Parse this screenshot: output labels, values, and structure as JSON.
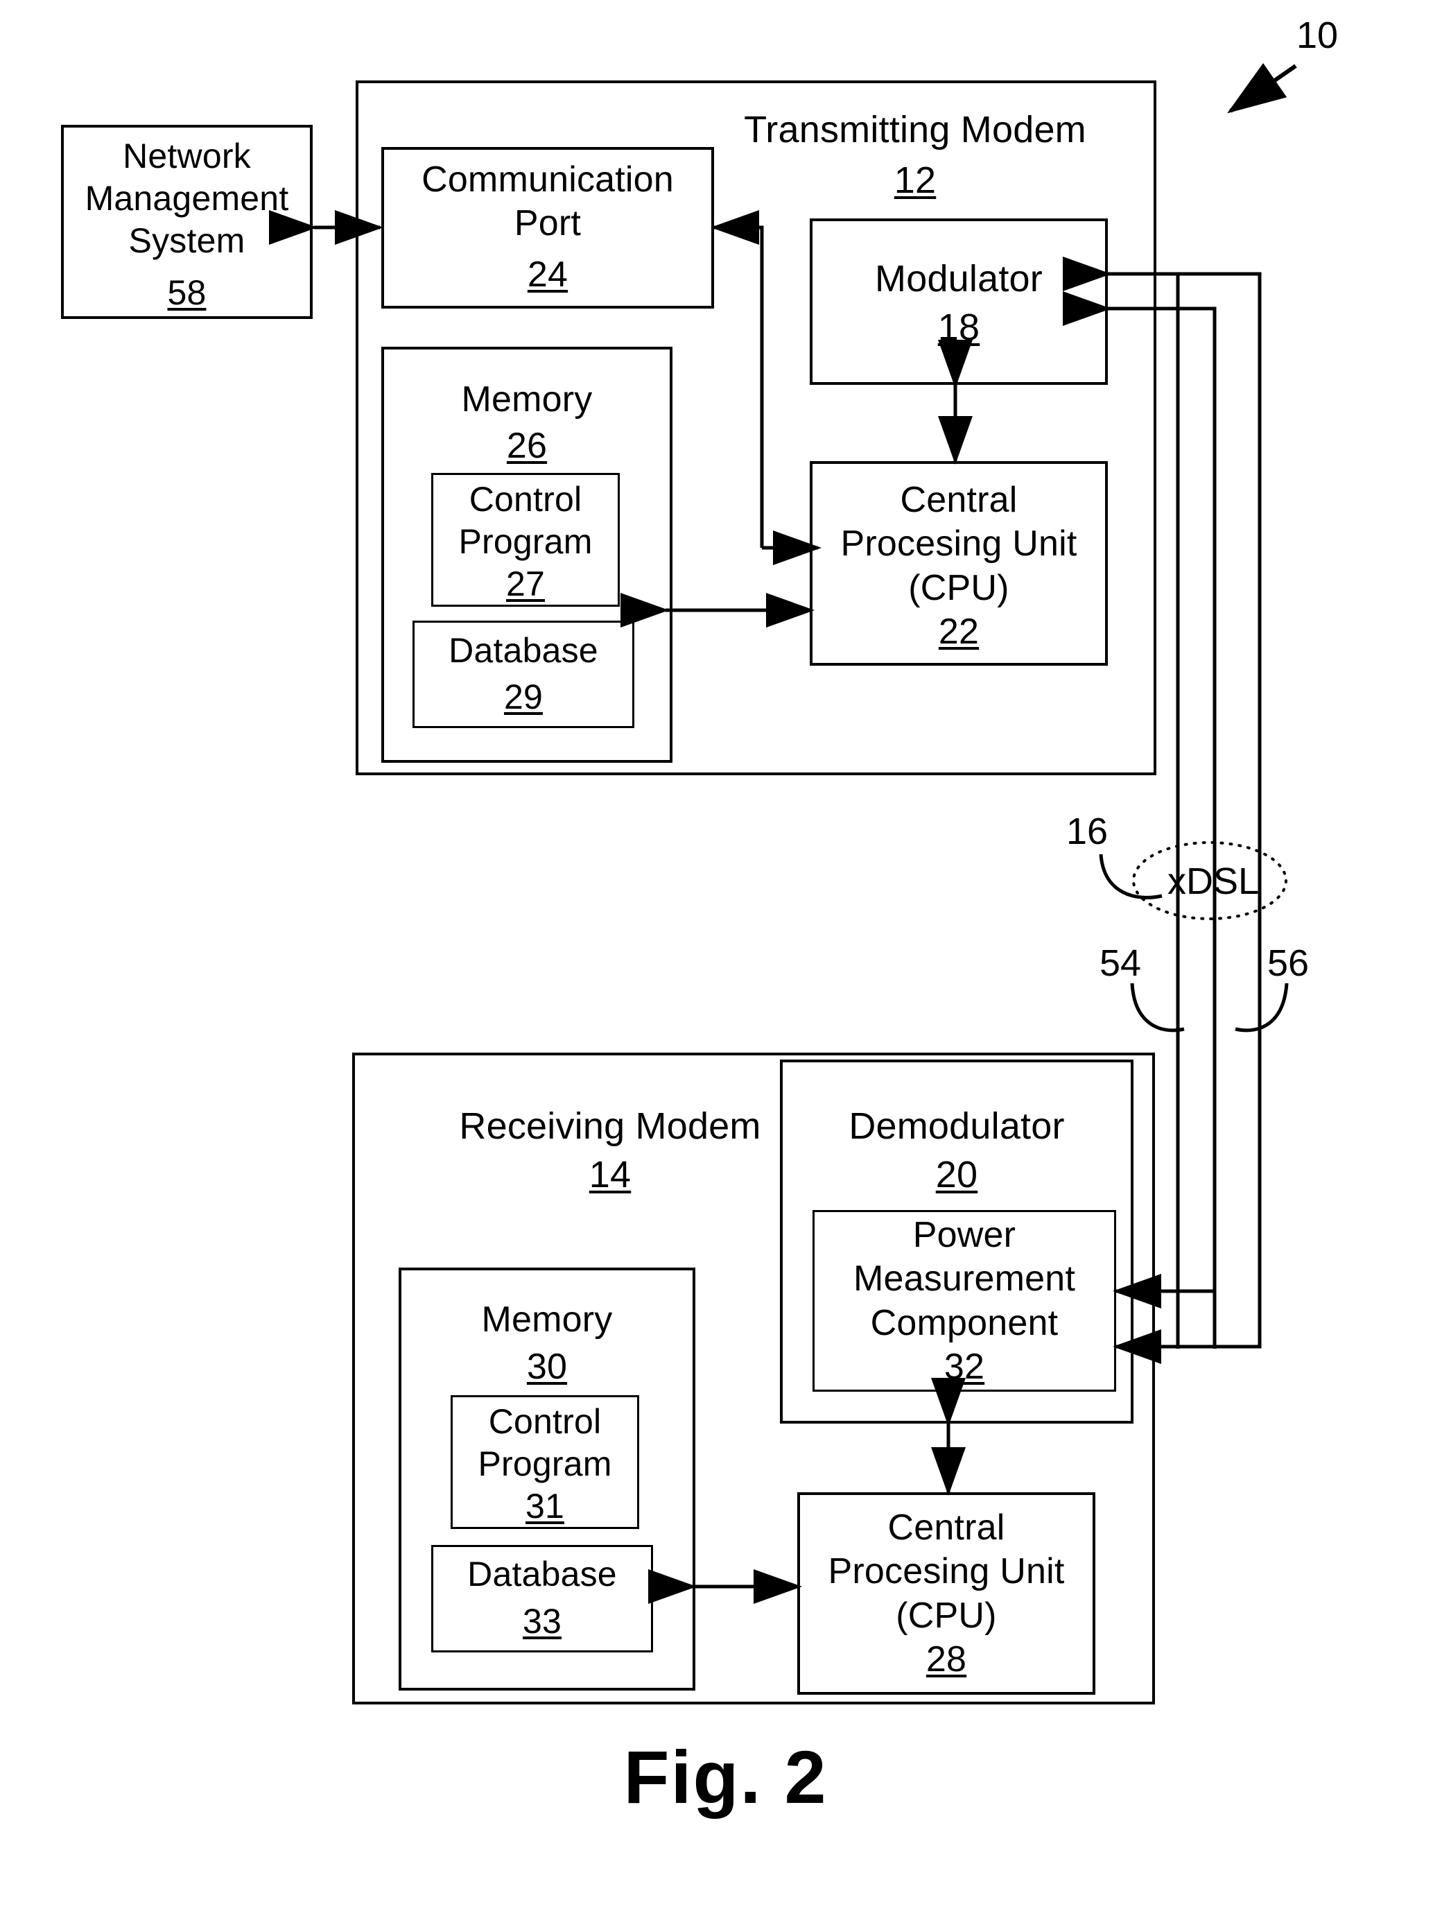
{
  "figure": {
    "caption": "Fig. 2",
    "system_ref": "10"
  },
  "nms": {
    "title": "Network\nManagement\nSystem",
    "ref": "58"
  },
  "transmitting_modem": {
    "title": "Transmitting Modem",
    "ref": "12",
    "communication_port": {
      "title": "Communication\nPort",
      "ref": "24"
    },
    "memory": {
      "title": "Memory",
      "ref": "26",
      "control_program": {
        "title": "Control\nProgram",
        "ref": "27"
      },
      "database": {
        "title": "Database",
        "ref": "29"
      }
    },
    "modulator": {
      "title": "Modulator",
      "ref": "18"
    },
    "cpu": {
      "title": "Central\nProcesing Unit\n(CPU)",
      "ref": "22"
    }
  },
  "network": {
    "label": "xDSL",
    "ref": "16",
    "upstream_ref": "54",
    "downstream_ref": "56"
  },
  "receiving_modem": {
    "title": "Receiving Modem",
    "ref": "14",
    "memory": {
      "title": "Memory",
      "ref": "30",
      "control_program": {
        "title": "Control\nProgram",
        "ref": "31"
      },
      "database": {
        "title": "Database",
        "ref": "33"
      }
    },
    "demodulator": {
      "title": "Demodulator",
      "ref": "20",
      "power_measurement": {
        "title": "Power\nMeasurement\nComponent",
        "ref": "32"
      }
    },
    "cpu": {
      "title": "Central\nProcesing Unit\n(CPU)",
      "ref": "28"
    }
  },
  "colors": {
    "ink": "#000000",
    "paper": "#ffffff"
  }
}
